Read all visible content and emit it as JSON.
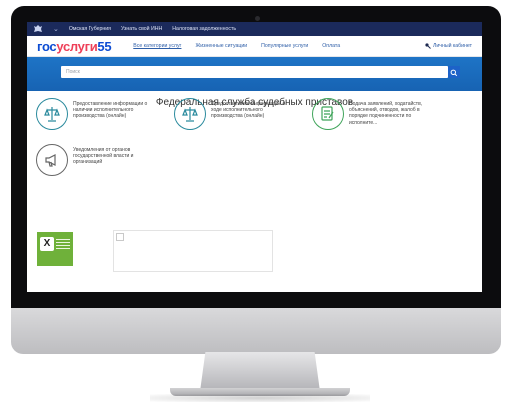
{
  "topbar": {
    "links": [
      "Омская Губерния",
      "Узнать свой ИНН",
      "Налоговая задолженность"
    ]
  },
  "header": {
    "logo_part1": "гос",
    "logo_part2": "услуги",
    "logo_part3": "55",
    "nav": [
      "Все категории услуг",
      "Жизненные ситуации",
      "Популярные услуги",
      "Оплата"
    ],
    "cabinet": "Личный кабинет"
  },
  "search": {
    "placeholder": "Поиск"
  },
  "main": {
    "title": "Федеральная служба судебных приставов",
    "services": [
      {
        "label": "Предоставление информации о наличии исполнительного производства (онлайн)",
        "icon": "scales-icon"
      },
      {
        "label": "Предоставление информации о ходе исполнительного производства (онлайн)",
        "icon": "scales-icon"
      },
      {
        "label": "Подача заявлений, ходатайств, объяснений, отводов, жалоб в порядке подчиненности по исполните...",
        "icon": "document-pen-icon"
      },
      {
        "label": "Уведомления от органов государственной власти и организаций",
        "icon": "megaphone-icon"
      }
    ]
  },
  "colors": {
    "topbar": "#1b2a5b",
    "brand_blue": "#0d4cd3",
    "brand_red": "#ee3f58",
    "search_band": "#1a6bbf",
    "service_teal": "#2a8a9d",
    "service_green": "#3fa45a",
    "service_grey": "#666666"
  }
}
